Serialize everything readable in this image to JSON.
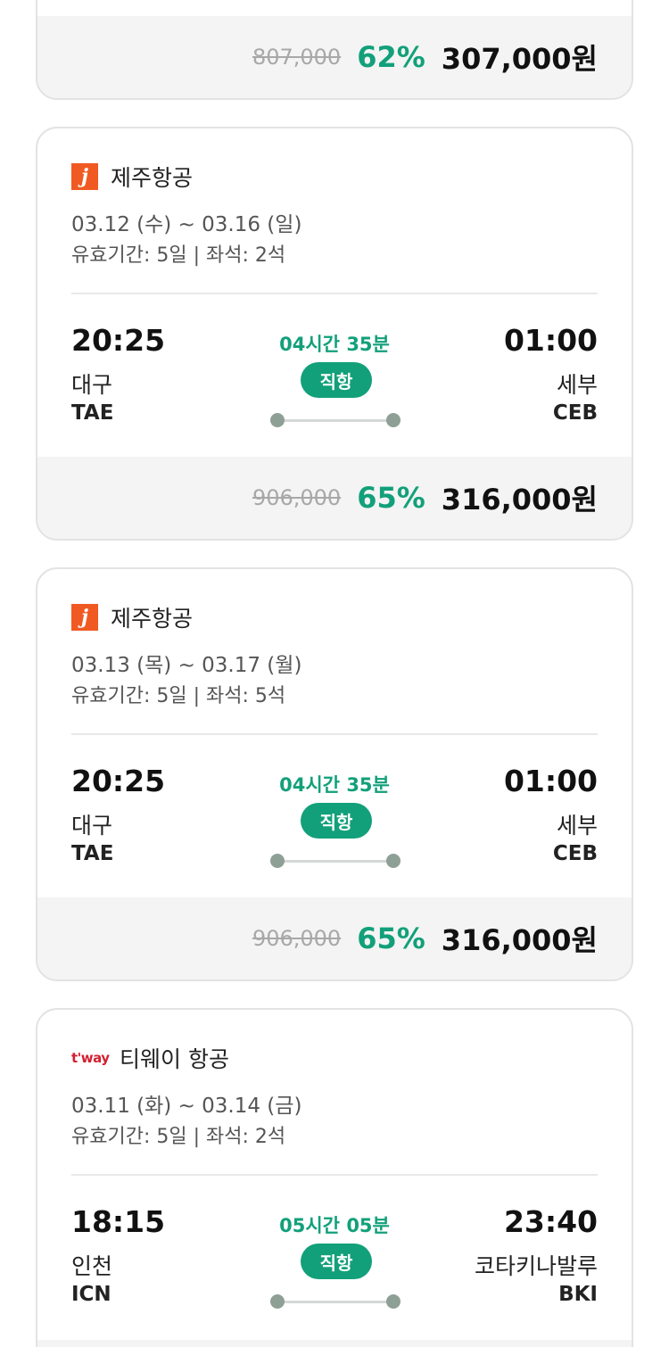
{
  "cards": [
    {
      "airline": "",
      "dates": "",
      "validity": "",
      "price": {
        "original": "807,000",
        "discount": "62%",
        "final": "307,000원"
      }
    },
    {
      "airline": "제주항공",
      "logo": "jeju-air-logo",
      "logo_text": "j",
      "dates": "03.12 (수) ~ 03.16 (일)",
      "validity": "유효기간: 5일 | 좌석: 2석",
      "departure": {
        "time": "20:25",
        "city": "대구",
        "code": "TAE"
      },
      "arrival": {
        "time": "01:00",
        "city": "세부",
        "code": "CEB"
      },
      "duration": "04시간 35분",
      "badge": "직항",
      "price": {
        "original": "906,000",
        "discount": "65%",
        "final": "316,000원"
      }
    },
    {
      "airline": "제주항공",
      "logo": "jeju-air-logo",
      "logo_text": "j",
      "dates": "03.13 (목) ~ 03.17 (월)",
      "validity": "유효기간: 5일 | 좌석: 5석",
      "departure": {
        "time": "20:25",
        "city": "대구",
        "code": "TAE"
      },
      "arrival": {
        "time": "01:00",
        "city": "세부",
        "code": "CEB"
      },
      "duration": "04시간 35분",
      "badge": "직항",
      "price": {
        "original": "906,000",
        "discount": "65%",
        "final": "316,000원"
      }
    },
    {
      "airline": "티웨이 항공",
      "logo": "tway-logo",
      "logo_text": "t'way",
      "dates": "03.11 (화) ~ 03.14 (금)",
      "validity": "유효기간: 5일 | 좌석: 2석",
      "departure": {
        "time": "18:15",
        "city": "인천",
        "code": "ICN"
      },
      "arrival": {
        "time": "23:40",
        "city": "코타키나발루",
        "code": "BKI"
      },
      "duration": "05시간 05분",
      "badge": "직항"
    }
  ],
  "colors": {
    "accent": "#12a07a",
    "jeju_orange": "#f05a22",
    "tway_red": "#d2202f",
    "footer_bg": "#f4f4f4",
    "strike_gray": "#a8a8a8"
  }
}
